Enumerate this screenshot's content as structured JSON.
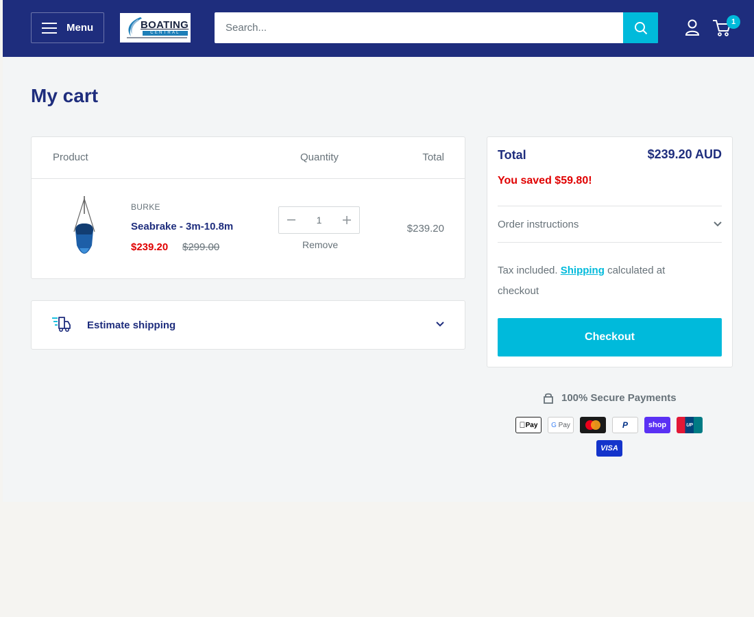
{
  "header": {
    "menu_label": "Menu",
    "logo_text": "BOATING",
    "logo_sub": "CENTRAL",
    "search_placeholder": "Search...",
    "cart_count": "1"
  },
  "page": {
    "title": "My cart"
  },
  "cart_table": {
    "headers": {
      "product": "Product",
      "quantity": "Quantity",
      "total": "Total"
    },
    "items": [
      {
        "brand": "BURKE",
        "title": "Seabrake - 3m-10.8m",
        "price": "$239.20",
        "compare_price": "$299.00",
        "quantity": "1",
        "remove_label": "Remove",
        "line_total": "$239.20"
      }
    ]
  },
  "shipping": {
    "label": "Estimate shipping"
  },
  "summary": {
    "total_label": "Total",
    "total_value": "$239.20 AUD",
    "saved": "You saved $59.80!",
    "order_instructions": "Order instructions",
    "tax_prefix": "Tax included.",
    "shipping_link": "Shipping",
    "tax_suffix": "calculated at checkout",
    "checkout_label": "Checkout"
  },
  "payments": {
    "secure_label": "100% Secure Payments",
    "methods": [
      "Apple Pay",
      "Google Pay",
      "Mastercard",
      "PayPal",
      "Shop Pay",
      "UnionPay",
      "Visa"
    ]
  },
  "colors": {
    "brand_navy": "#1e2d7d",
    "accent_cyan": "#00badb",
    "sale_red": "#e00000"
  }
}
